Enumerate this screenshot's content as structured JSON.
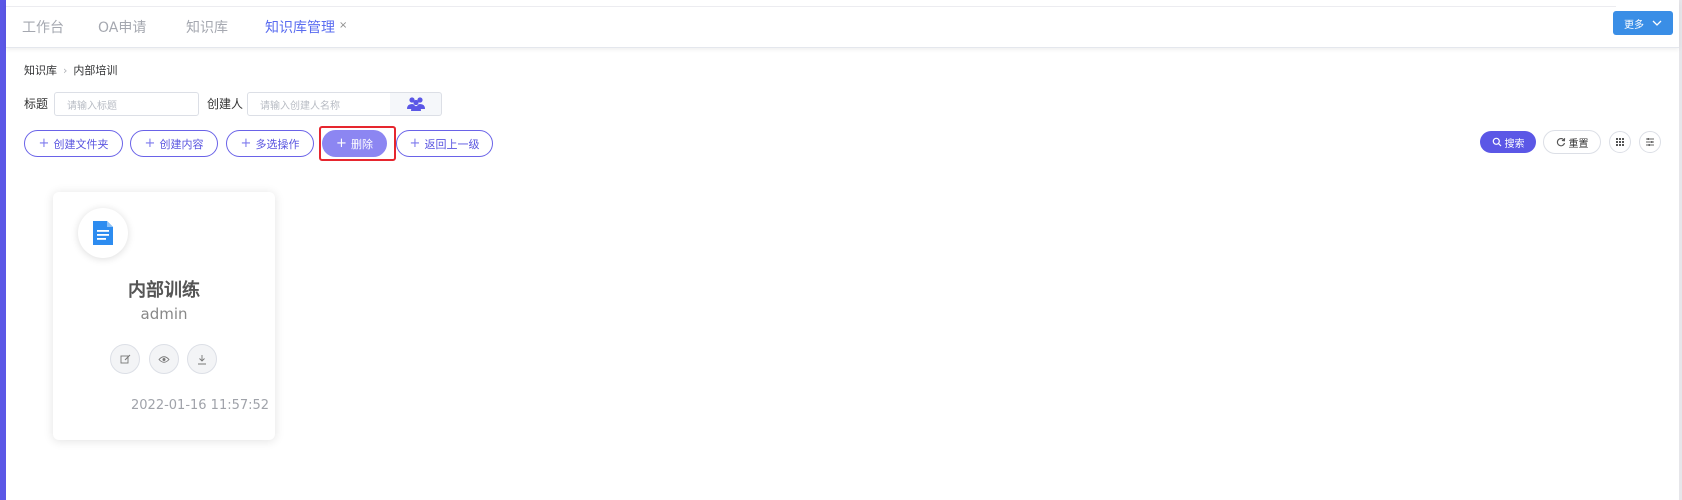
{
  "tabs": [
    {
      "label": "工作台",
      "active": false
    },
    {
      "label": "OA申请",
      "active": false
    },
    {
      "label": "知识库",
      "active": false
    },
    {
      "label": "知识库管理",
      "active": true
    }
  ],
  "tab_close": "×",
  "more_button": "更多",
  "breadcrumb": [
    "知识库",
    "内部培训"
  ],
  "filters": {
    "title_label": "标题",
    "title_placeholder": "请输入标题",
    "creator_label": "创建人",
    "creator_placeholder": "请输入创建人名称"
  },
  "actions": {
    "create_folder": "创建文件夹",
    "create_content": "创建内容",
    "multi_select": "多选操作",
    "delete": "删除",
    "go_back": "返回上一级"
  },
  "toolbar": {
    "search": "搜索",
    "reset": "重置"
  },
  "card": {
    "title": "内部训练",
    "author": "admin",
    "date": "2022-01-16 11:57:52",
    "icons": [
      "edit-icon",
      "eye-icon",
      "download-icon"
    ]
  },
  "colors": {
    "accent": "#5b57e6",
    "active_tab": "#5a6cf0",
    "more_button": "#3a8ee6",
    "delete_button": "#8c86f2",
    "highlight": "#e6262e",
    "doc_icon": "#2d8cf0"
  }
}
